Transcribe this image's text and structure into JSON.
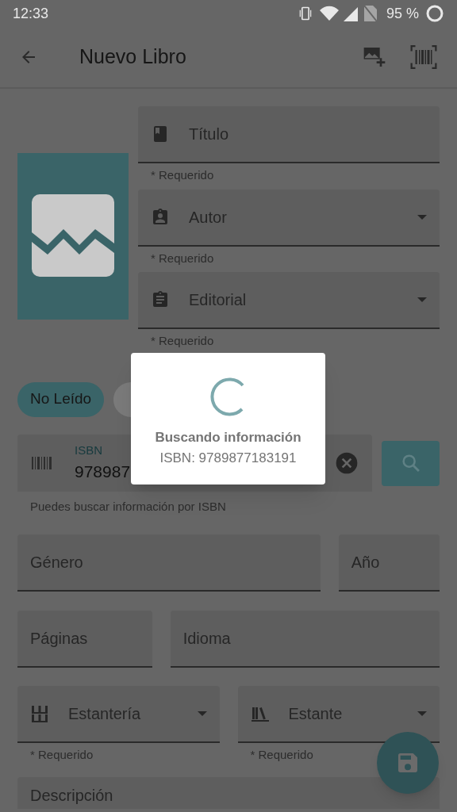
{
  "status_bar": {
    "time": "12:33",
    "battery": "95 %"
  },
  "app_bar": {
    "title": "Nuevo Libro"
  },
  "top_fields": [
    {
      "label": "Título",
      "dropdown": false,
      "helper": "* Requerido"
    },
    {
      "label": "Autor",
      "dropdown": true,
      "helper": "* Requerido"
    },
    {
      "label": "Editorial",
      "dropdown": true,
      "helper": "* Requerido"
    }
  ],
  "chips": [
    {
      "label": "No Leído",
      "selected": true
    },
    {
      "selected": false
    }
  ],
  "isbn": {
    "label": "ISBN",
    "value": "978987",
    "helper": "Puedes buscar información por ISBN"
  },
  "rows": [
    [
      {
        "label": "Género"
      },
      {
        "label": "Año"
      }
    ],
    [
      {
        "label": "Páginas"
      },
      {
        "label": "Idioma"
      }
    ]
  ],
  "shelves": [
    {
      "label": "Estantería",
      "helper": "* Requerido"
    },
    {
      "label": "Estante",
      "helper": "* Requerido"
    }
  ],
  "description": {
    "label": "Descripción"
  },
  "dialog": {
    "title": "Buscando información",
    "message": "ISBN: 9789877183191"
  }
}
